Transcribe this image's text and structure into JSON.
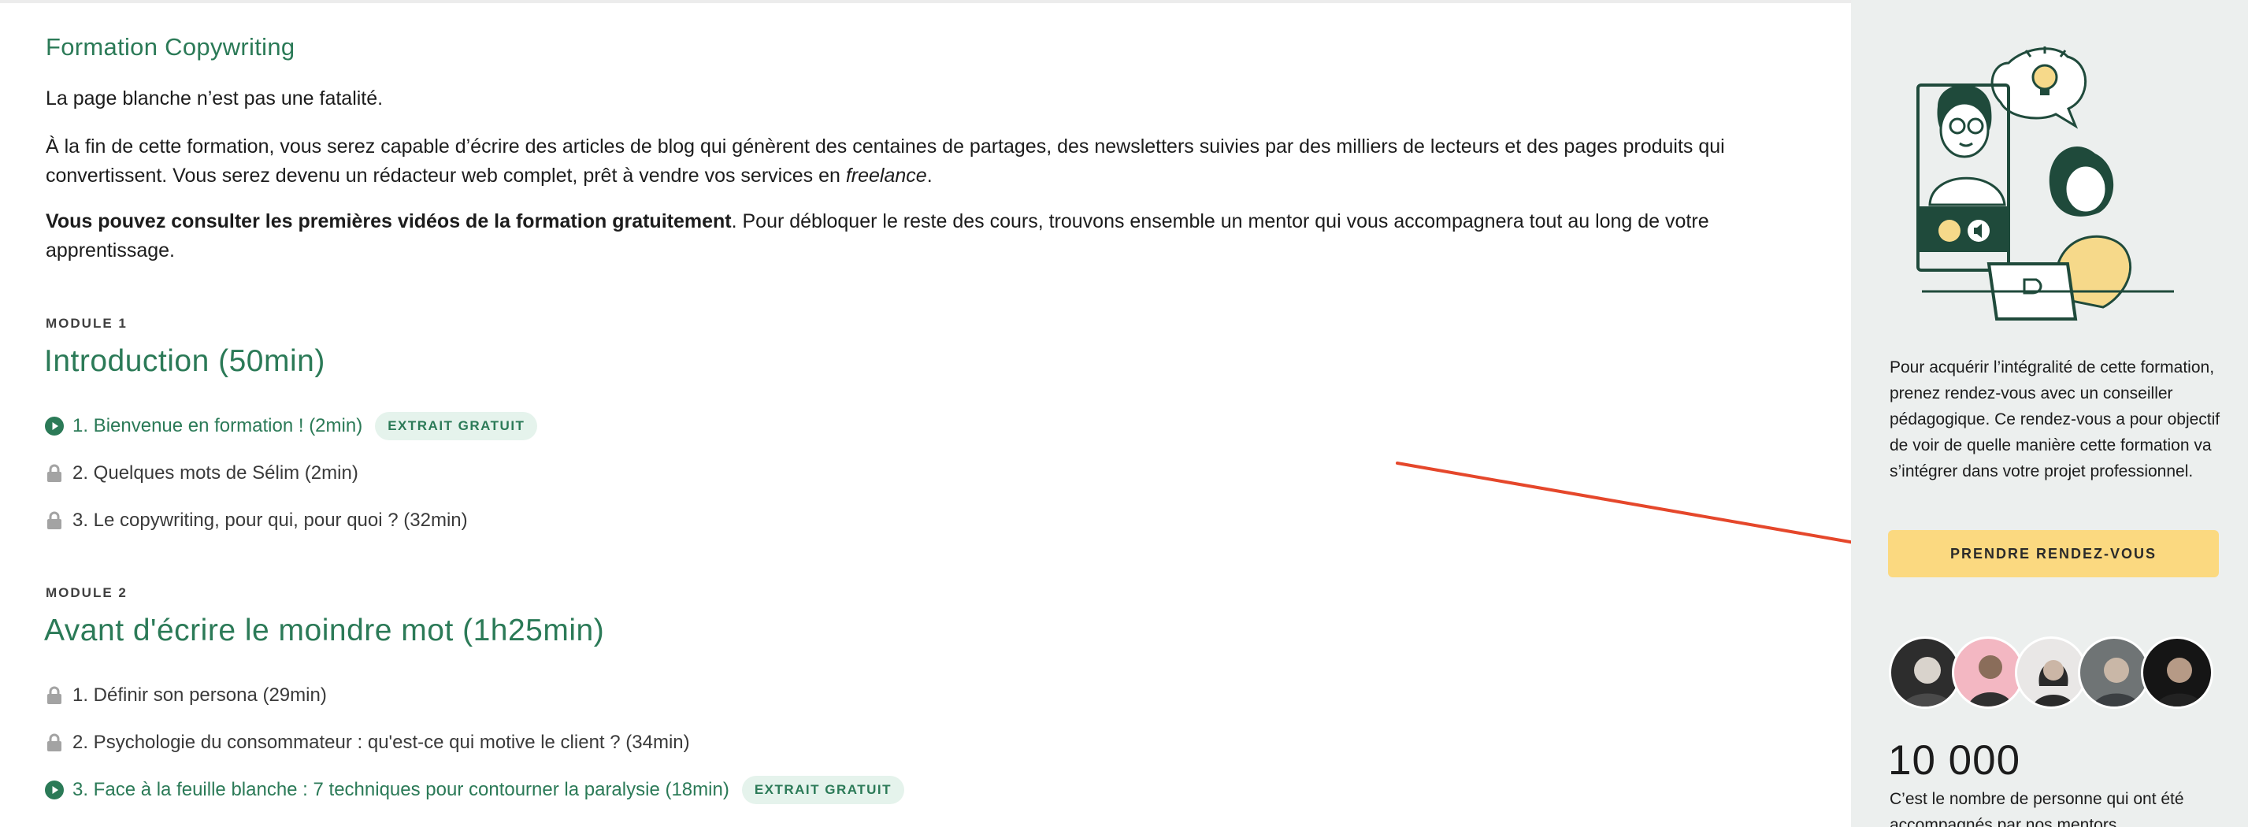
{
  "course": {
    "title": "Formation Copywriting",
    "intro": "La page blanche n’est pas une fatalité.",
    "desc_before": "À la fin de cette formation, vous serez capable d’écrire des articles de blog qui génèrent des centaines de partages, des newsletters suivies par des milliers de lecteurs et des pages produits qui convertissent. Vous serez devenu un rédacteur web complet, prêt à vendre vos services en ",
    "desc_em": "freelance",
    "desc_after": ".",
    "free_bold": "Vous pouvez consulter les premières vidéos de la formation gratuitement",
    "free_rest": ". Pour débloquer le reste des cours, trouvons ensemble un mentor qui vous accompagnera tout au long de votre apprentissage."
  },
  "modules": [
    {
      "label": "MODULE 1",
      "title": "Introduction (50min)",
      "lessons": [
        {
          "text": "1. Bienvenue en formation ! (2min)",
          "badge": "EXTRAIT GRATUIT",
          "icon": "play-icon"
        },
        {
          "text": "2. Quelques mots de Sélim (2min)",
          "icon": "lock-icon"
        },
        {
          "text": "3. Le copywriting, pour qui, pour quoi ? (32min)",
          "icon": "lock-icon"
        }
      ]
    },
    {
      "label": "MODULE 2",
      "title": "Avant d'écrire le moindre mot (1h25min)",
      "lessons": [
        {
          "text": "1. Définir son persona (29min)",
          "icon": "lock-icon"
        },
        {
          "text": "2. Psychologie du consommateur : qu'est-ce qui motive le client ? (34min)",
          "icon": "lock-icon"
        },
        {
          "text": "3. Face à la feuille blanche : 7 techniques pour contourner la paralysie (18min)",
          "badge": "EXTRAIT GRATUIT",
          "icon": "play-icon"
        }
      ]
    }
  ],
  "sidebar": {
    "illustration": "mentor-video-call-illustration",
    "text": "Pour acquérir l’intégralité de cette formation, prenez rendez-vous avec un conseiller pédagogique. Ce rendez-vous a pour objectif de voir de quelle manière cette formation va s’intégrer dans votre projet professionnel.",
    "cta": "PRENDRE RENDEZ-VOUS",
    "stat_number": "10 000",
    "stat_text": "C’est le nombre de personne qui ont été accompagnés par nos mentors"
  },
  "colors": {
    "accent_green": "#2b7a57",
    "badge_bg": "#e5f3ec",
    "cta_yellow": "#fbd980",
    "sidebar_bg": "#ecefee",
    "annotation_arrow": "#e5472b",
    "illustration_dark": "#1f4a3b",
    "illustration_yellow": "#f6d98a"
  }
}
